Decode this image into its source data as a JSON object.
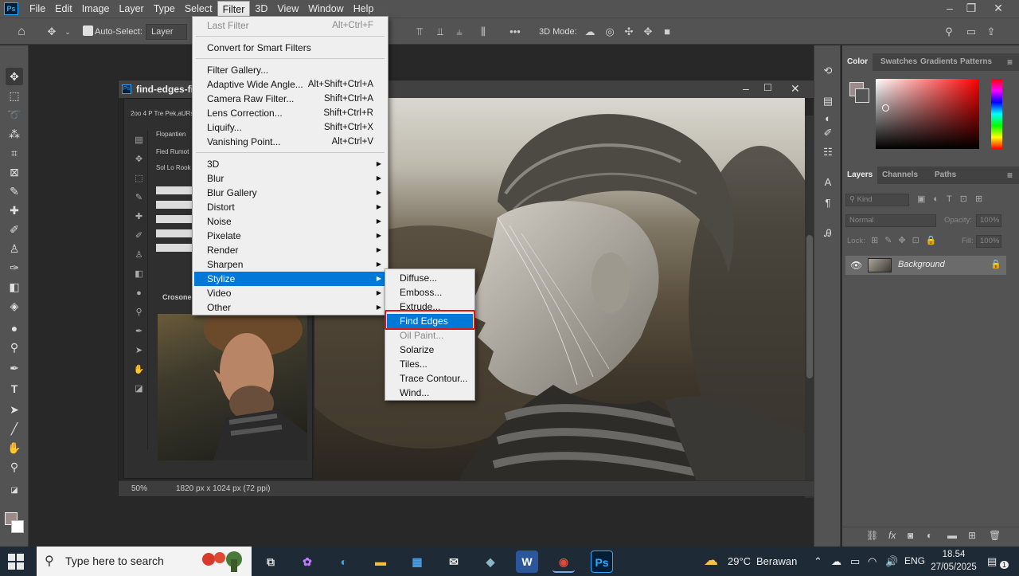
{
  "menubar": {
    "logo": "Ps",
    "items": [
      "File",
      "Edit",
      "Image",
      "Layer",
      "Type",
      "Select",
      "Filter",
      "3D",
      "View",
      "Window",
      "Help"
    ],
    "active_index": 6
  },
  "options": {
    "auto_select_label": "Auto-Select:",
    "auto_select_value": "Layer",
    "mode_3d_label": "3D Mode:"
  },
  "document": {
    "title": "find-edges-filt",
    "zoom": "50%",
    "dimensions": "1820 px x 1024 px (72 ppi)"
  },
  "inner_screenshot": {
    "labels": [
      "2oo 4 P Tre Pek,aURs",
      "Flopantien",
      "Fied Rumot",
      "Sol Lo Rook",
      "Crosones"
    ]
  },
  "filter_menu": {
    "items": [
      {
        "label": "Last Filter",
        "shortcut": "Alt+Ctrl+F",
        "disabled": true
      },
      {
        "label": "Convert for Smart Filters",
        "shortcut": ""
      },
      {
        "label": "Filter Gallery...",
        "shortcut": ""
      },
      {
        "label": "Adaptive Wide Angle...",
        "shortcut": "Alt+Shift+Ctrl+A"
      },
      {
        "label": "Camera Raw Filter...",
        "shortcut": "Shift+Ctrl+A"
      },
      {
        "label": "Lens Correction...",
        "shortcut": "Shift+Ctrl+R"
      },
      {
        "label": "Liquify...",
        "shortcut": "Shift+Ctrl+X"
      },
      {
        "label": "Vanishing Point...",
        "shortcut": "Alt+Ctrl+V"
      },
      {
        "label": "3D",
        "submenu": true
      },
      {
        "label": "Blur",
        "submenu": true
      },
      {
        "label": "Blur Gallery",
        "submenu": true
      },
      {
        "label": "Distort",
        "submenu": true
      },
      {
        "label": "Noise",
        "submenu": true
      },
      {
        "label": "Pixelate",
        "submenu": true
      },
      {
        "label": "Render",
        "submenu": true
      },
      {
        "label": "Sharpen",
        "submenu": true
      },
      {
        "label": "Stylize",
        "submenu": true,
        "highlighted": true
      },
      {
        "label": "Video",
        "submenu": true
      },
      {
        "label": "Other",
        "submenu": true
      }
    ]
  },
  "stylize_submenu": {
    "items": [
      {
        "label": "Diffuse..."
      },
      {
        "label": "Emboss..."
      },
      {
        "label": "Extrude..."
      },
      {
        "label": "Find Edges",
        "highlighted": true
      },
      {
        "label": "Oil Paint...",
        "disabled": true
      },
      {
        "label": "Solarize"
      },
      {
        "label": "Tiles..."
      },
      {
        "label": "Trace Contour..."
      },
      {
        "label": "Wind..."
      }
    ],
    "annotation_color": "#d8151a"
  },
  "color_panel": {
    "tabs": [
      "Color",
      "Swatches",
      "Gradients",
      "Patterns"
    ],
    "foreground": "#9a8a8a"
  },
  "layers_panel": {
    "tabs": [
      "Layers",
      "Channels",
      "Paths"
    ],
    "search_placeholder": "Kind",
    "blend_mode": "Normal",
    "opacity_label": "Opacity:",
    "opacity_value": "100%",
    "lock_label": "Lock:",
    "fill_label": "Fill:",
    "fill_value": "100%",
    "layer_name": "Background"
  },
  "taskbar": {
    "search_placeholder": "Type here to search",
    "weather_temp": "29°C",
    "weather_text": "Berawan",
    "language": "ENG",
    "time": "18.54",
    "date": "27/05/2025",
    "notification_count": "1"
  },
  "colors": {
    "menu_highlight": "#0078d7",
    "ps_blue": "#31a8ff",
    "panel_bg": "#535353"
  }
}
